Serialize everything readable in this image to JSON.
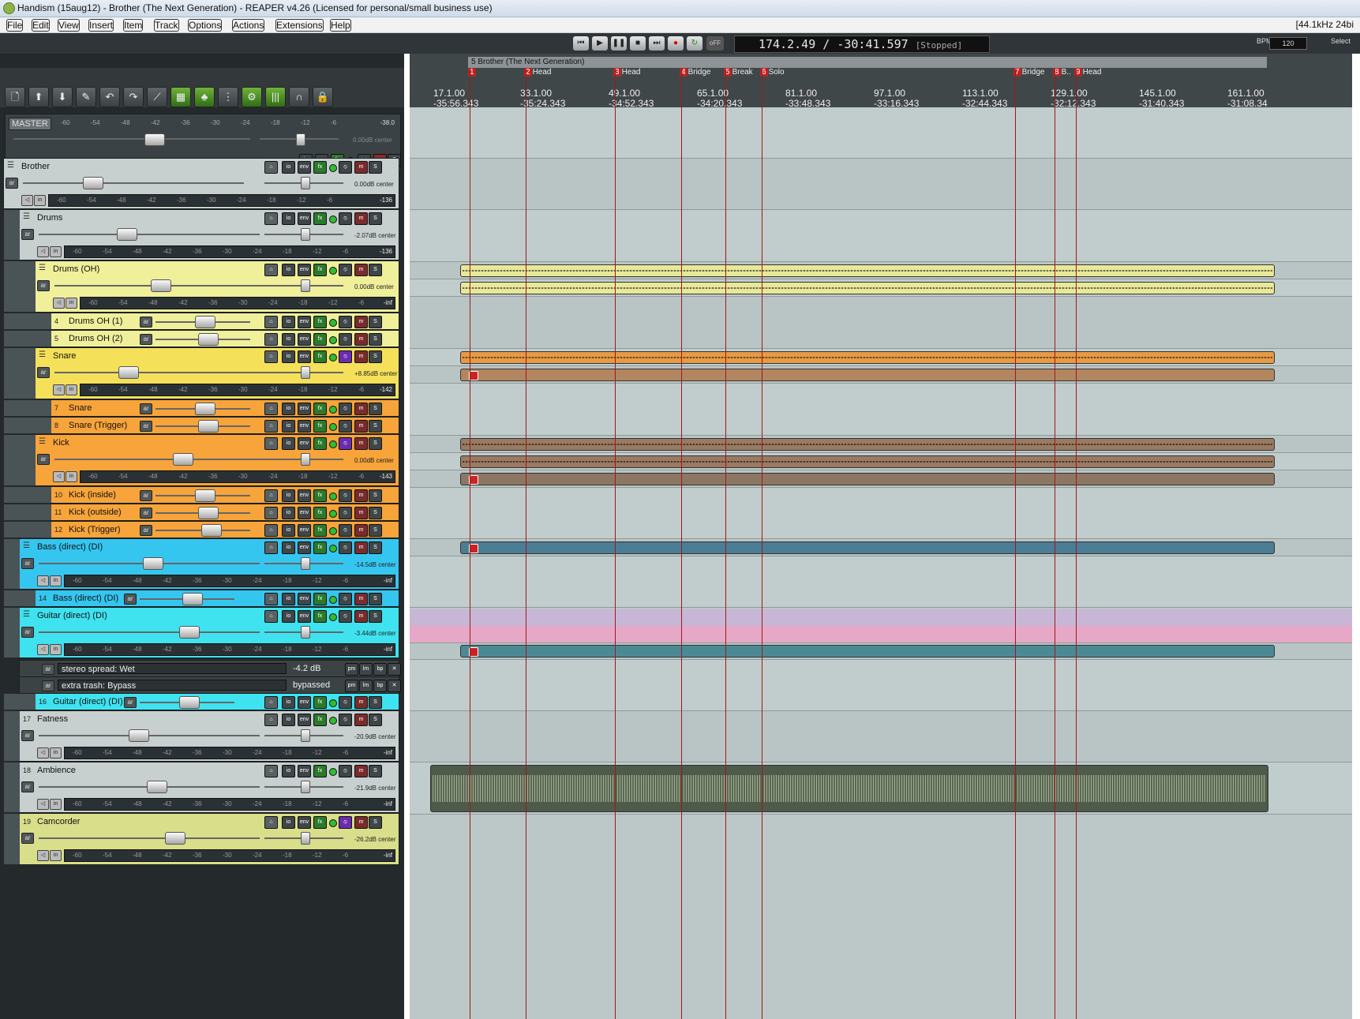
{
  "window": {
    "title": "Handism (15aug12) - Brother (The Next Generation) - REAPER v4.26 (Licensed for personal/small business use)"
  },
  "menu": {
    "items": [
      "File",
      "Edit",
      "View",
      "Insert",
      "Item",
      "Track",
      "Options",
      "Actions",
      "Extensions",
      "Help"
    ],
    "rate": "[44.1kHz 24bi"
  },
  "transport": {
    "time": "174.2.49 / -30:41.597",
    "state": "[Stopped]",
    "repeat_off": "oFF",
    "bpm_label": "BPM",
    "bpm": "120",
    "select_label": "Select"
  },
  "toolbar": {
    "icons": [
      "new-project-icon",
      "open-icon",
      "save-icon",
      "settings-icon",
      "undo-icon",
      "redo-icon",
      "grid-icon",
      "snap-icon",
      "ripple-icon",
      "metronome-icon",
      "cycle-icon",
      "lock-icon",
      "headphones-icon",
      "lock-icon"
    ]
  },
  "master": {
    "label": "MASTER",
    "scale": [
      "-60",
      "-54",
      "-48",
      "-42",
      "-36",
      "-30",
      "-24",
      "-18",
      "-12",
      "-6"
    ],
    "peak": "-38.0",
    "volume": "0.00dB center"
  },
  "tracks": [
    {
      "num": "",
      "name": "Brother",
      "volume": "0.00dB center",
      "peak": "-136",
      "color": "#c7cfcf"
    },
    {
      "num": "",
      "name": "Drums",
      "volume": "-2.07dB center",
      "peak": "-136",
      "color": "#c7cfcf"
    },
    {
      "num": "",
      "name": "Drums (OH)",
      "volume": "0.00dB center",
      "peak": "-inf",
      "color": "#f0ef9a"
    },
    {
      "num": "4",
      "name": "Drums OH (1)",
      "color": "#f0ef9a"
    },
    {
      "num": "5",
      "name": "Drums OH (2)",
      "color": "#f0ef9a"
    },
    {
      "num": "",
      "name": "Snare",
      "volume": "+8.85dB center",
      "peak": "-142",
      "color": "#f5e05a"
    },
    {
      "num": "7",
      "name": "Snare",
      "color": "#f7a43a"
    },
    {
      "num": "8",
      "name": "Snare (Trigger)",
      "color": "#f7a43a"
    },
    {
      "num": "",
      "name": "Kick",
      "volume": "0.00dB center",
      "peak": "-143",
      "color": "#f7a43a"
    },
    {
      "num": "10",
      "name": "Kick (inside)",
      "color": "#f7a43a"
    },
    {
      "num": "11",
      "name": "Kick (outside)",
      "color": "#f7a43a"
    },
    {
      "num": "12",
      "name": "Kick (Trigger)",
      "color": "#f7a43a"
    },
    {
      "num": "",
      "name": "Bass (direct) (DI)",
      "volume": "-14.5dB center",
      "peak": "-inf",
      "color": "#35c6f0"
    },
    {
      "num": "14",
      "name": "Bass (direct) (DI)",
      "color": "#35c6f0"
    },
    {
      "num": "",
      "name": "Guitar (direct) (DI)",
      "volume": "-3.44dB center",
      "peak": "-inf",
      "color": "#3fe3ef"
    },
    {
      "num": "16",
      "name": "Guitar (direct) (DI)",
      "color": "#3fe3ef"
    },
    {
      "num": "17",
      "name": "Fatness",
      "volume": "-20.9dB center",
      "peak": "-inf",
      "color": "#c7cfcf"
    },
    {
      "num": "18",
      "name": "Ambience",
      "volume": "-21.9dB center",
      "peak": "-inf",
      "color": "#c7cfcf"
    },
    {
      "num": "19",
      "name": "Camcorder",
      "volume": "-26.2dB center",
      "peak": "-inf",
      "color": "#d9de8a"
    }
  ],
  "fx_lanes": [
    {
      "name": "stereo spread: Wet",
      "value": "-4.2 dB"
    },
    {
      "name": "extra trash: Bypass",
      "value": "bypassed"
    }
  ],
  "buttons": {
    "io": "io",
    "env": "env",
    "fx": "fx",
    "mute": "m",
    "solo": "S",
    "arm": "ar",
    "in": "in",
    "pm": "pm",
    "lm": "lm",
    "bp": "bp"
  },
  "timeline": {
    "region": "5 Brother (The Next Generation)",
    "markers": [
      {
        "n": "1",
        "label": ""
      },
      {
        "n": "2",
        "label": "Head"
      },
      {
        "n": "3",
        "label": "Head"
      },
      {
        "n": "4",
        "label": "Bridge"
      },
      {
        "n": "5",
        "label": "Break"
      },
      {
        "n": "6",
        "label": "Solo"
      },
      {
        "n": "7",
        "label": "Bridge"
      },
      {
        "n": "8",
        "label": "B.."
      },
      {
        "n": "9",
        "label": "Head"
      }
    ],
    "ticks": [
      {
        "bar": "17.1.00",
        "time": "-35:56.343"
      },
      {
        "bar": "33.1.00",
        "time": "-35:24.343"
      },
      {
        "bar": "49.1.00",
        "time": "-34:52.343"
      },
      {
        "bar": "65.1.00",
        "time": "-34:20.343"
      },
      {
        "bar": "81.1.00",
        "time": "-33:48.343"
      },
      {
        "bar": "97.1.00",
        "time": "-33:16.343"
      },
      {
        "bar": "113.1.00",
        "time": "-32:44.343"
      },
      {
        "bar": "129.1.00",
        "time": "-32:12.343"
      },
      {
        "bar": "145.1.00",
        "time": "-31:40.343"
      },
      {
        "bar": "161.1.00",
        "time": "-31:08.34"
      }
    ]
  }
}
